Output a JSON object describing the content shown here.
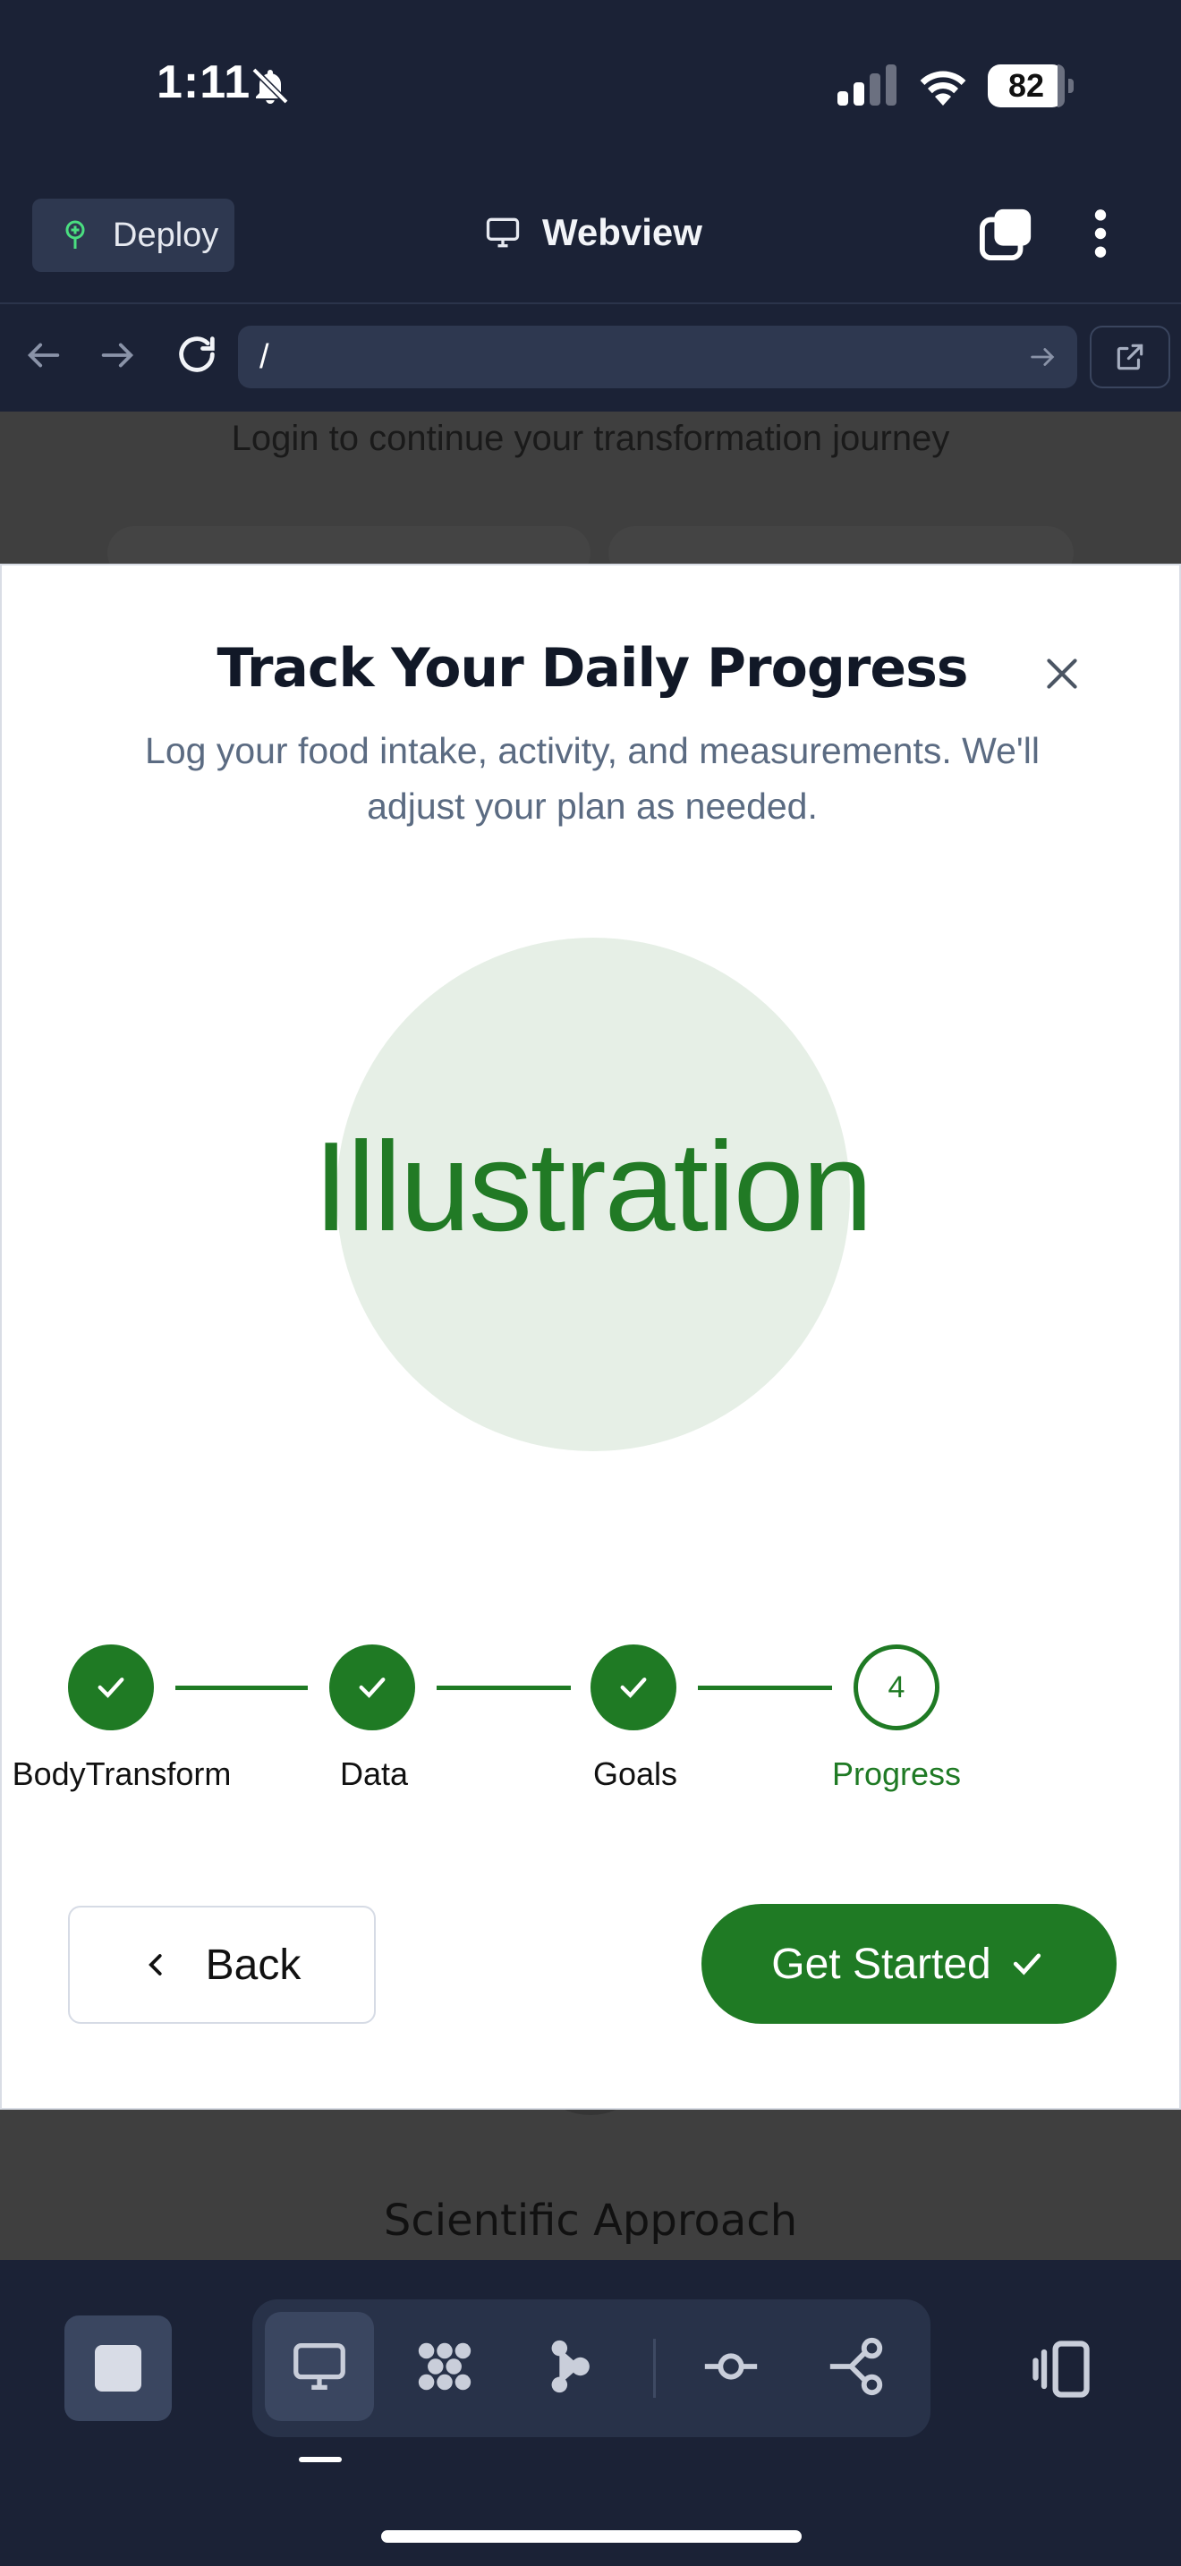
{
  "status_bar": {
    "time": "1:11",
    "battery": "82",
    "icons": [
      "bell-off-icon",
      "signal-icon",
      "wifi-icon",
      "battery-icon"
    ]
  },
  "header": {
    "deploy_label": "Deploy",
    "webview_label": "Webview"
  },
  "url_bar": {
    "value": "/"
  },
  "background_page": {
    "login_subtitle": "Login to continue your transformation journey",
    "section_title": "Scientific Approach"
  },
  "modal": {
    "title": "Track Your Daily Progress",
    "subtitle": "Log your food intake, activity, and measurements. We'll adjust your plan as needed.",
    "illustration": "Illustration",
    "steps": [
      {
        "label": "BodyTransform",
        "state": "done"
      },
      {
        "label": "Data",
        "state": "done"
      },
      {
        "label": "Goals",
        "state": "done"
      },
      {
        "label": "Progress",
        "state": "current",
        "number": "4"
      }
    ],
    "back_label": "Back",
    "start_label": "Get Started"
  },
  "colors": {
    "primary_green": "#1f7a24",
    "illustration_bg": "#e6efe6",
    "app_bg": "#1b2236"
  }
}
